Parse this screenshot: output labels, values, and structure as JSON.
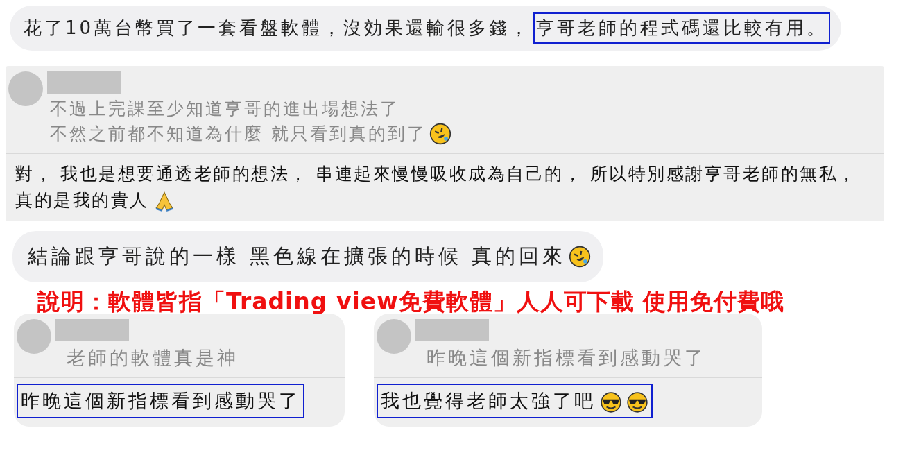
{
  "messages": [
    {
      "kind": "bubble",
      "parts": [
        {
          "text": "花了10萬台幣買了一套看盤軟體，沒効果還輸很多錢，",
          "highlighted": false
        },
        {
          "text": "亨哥老師的程式碼還比較有用。",
          "highlighted": true
        }
      ]
    },
    {
      "kind": "reply",
      "quote": [
        "不過上完課至少知道亨哥的進出場想法了",
        "不然之前都不知道為什麼 就只看到真的到了"
      ],
      "reply": "對， 我也是想要通透老師的想法， 串連起來慢慢吸收成為自己的， 所以特別感謝亨哥老師的無私，真的是我的貴人",
      "highlighted": false
    },
    {
      "kind": "bubble",
      "parts": [
        {
          "text": "結論跟亨哥說的一樣 黑色線在擴張的時候 真的回來",
          "highlighted": false
        }
      ]
    },
    {
      "kind": "note",
      "text": "說明：軟體皆指「Trading view免費軟體」人人可下載 使用免付費哦"
    },
    {
      "kind": "pair",
      "items": [
        {
          "quote": [
            "老師的軟體真是神"
          ],
          "reply": "昨晚這個新指標看到感動哭了",
          "highlighted": true
        },
        {
          "quote": [
            "昨晚這個新指標看到感動哭了"
          ],
          "reply": "我也覺得老師太強了吧",
          "highlighted": true
        }
      ]
    }
  ]
}
